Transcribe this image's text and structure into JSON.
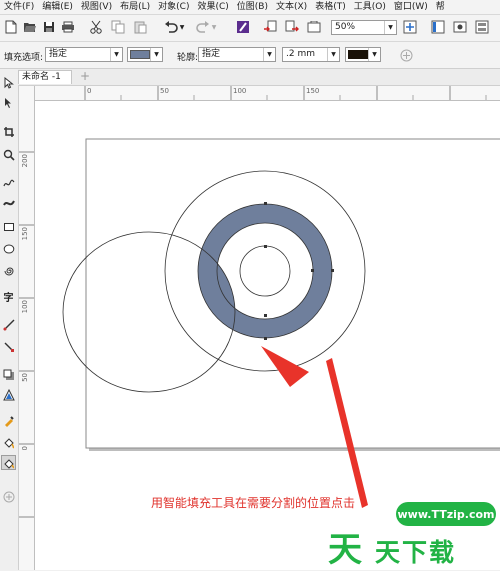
{
  "menu": [
    "文件(F)",
    "编辑(E)",
    "视图(V)",
    "布局(L)",
    "对象(C)",
    "效果(C)",
    "位图(B)",
    "文本(X)",
    "表格(T)",
    "工具(O)",
    "窗口(W)",
    "帮"
  ],
  "toolbar": {
    "zoom_value": "50%"
  },
  "property_bar": {
    "fill_label": "填充选项:",
    "fill_mode": "指定",
    "fill_color": "#6f7f9c",
    "outline_label": "轮廓:",
    "outline_mode": "指定",
    "outline_width": ".2 mm",
    "outline_color": "#1a1208"
  },
  "document_tab": {
    "label": "未命名 -1"
  },
  "rulers": {
    "horizontal": [
      "0",
      "50",
      "100",
      "150"
    ],
    "vertical": [
      "200",
      "150",
      "100",
      "50",
      "0"
    ]
  },
  "canvas": {
    "fill_color": "#6f7f9c",
    "arrow_color": "#e8332a"
  },
  "annotation": {
    "caption": "用智能填充工具在需要分割的位置点击"
  },
  "watermark": {
    "badge": "www.TTzip.com",
    "logo_big": "天",
    "logo_text": "天下载"
  }
}
